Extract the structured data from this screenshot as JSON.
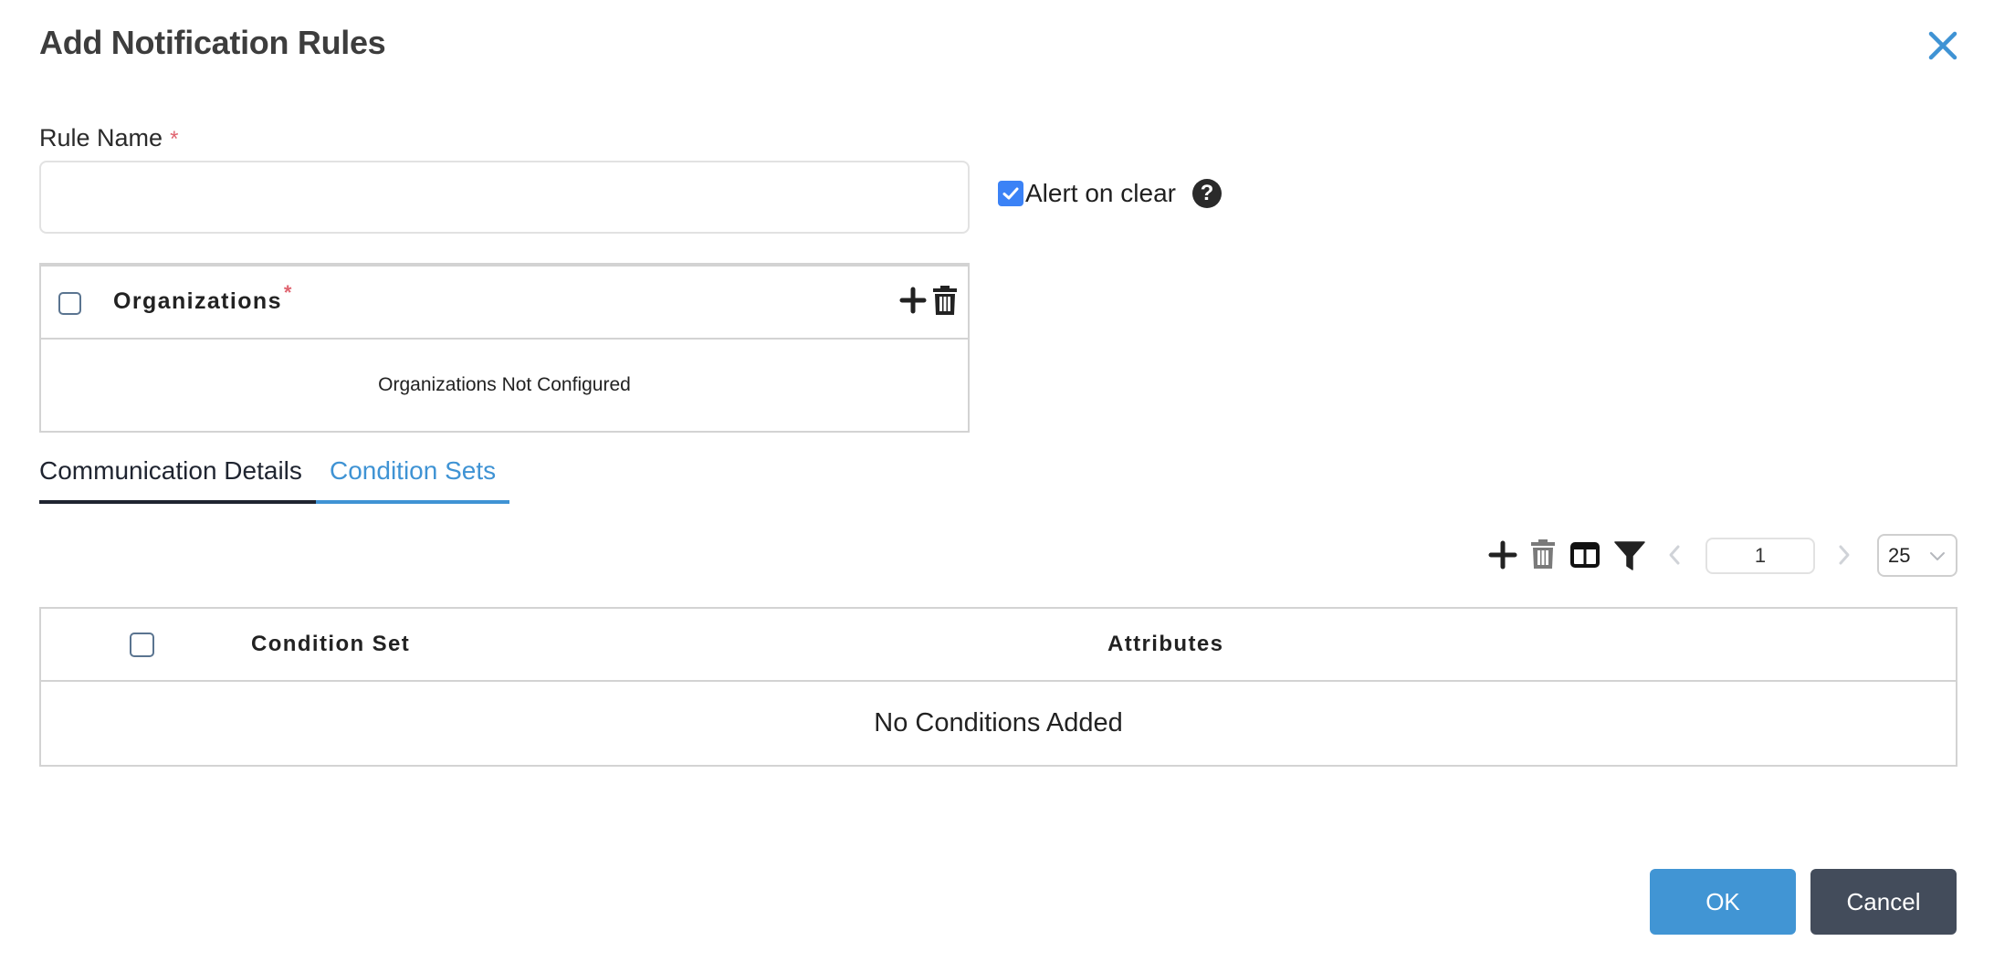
{
  "dialog": {
    "title": "Add Notification Rules",
    "close_icon": "close-icon"
  },
  "rule_name": {
    "label": "Rule Name",
    "required_mark": "*",
    "value": "",
    "placeholder": ""
  },
  "alert_on_clear": {
    "label": "Alert on clear",
    "checked": true,
    "help_icon": "?"
  },
  "organizations": {
    "title": "Organizations",
    "required_mark": "*",
    "empty_message": "Organizations Not Configured",
    "add_icon": "plus-icon",
    "delete_icon": "trash-icon"
  },
  "tabs": [
    {
      "label": "Communication Details",
      "active": false
    },
    {
      "label": "Condition Sets",
      "active": true
    }
  ],
  "condition_toolbar": {
    "icons": [
      "plus-icon",
      "trash-icon",
      "columns-icon",
      "filter-icon"
    ],
    "page": "1",
    "page_size": "25"
  },
  "condition_table": {
    "columns": [
      "Condition Set",
      "Attributes"
    ],
    "empty_message": "No Conditions Added"
  },
  "footer": {
    "ok_label": "OK",
    "cancel_label": "Cancel"
  },
  "colors": {
    "accent": "#4195d4",
    "checkbox": "#3b82f6",
    "required": "#e06470",
    "cancel": "#434c5b"
  }
}
